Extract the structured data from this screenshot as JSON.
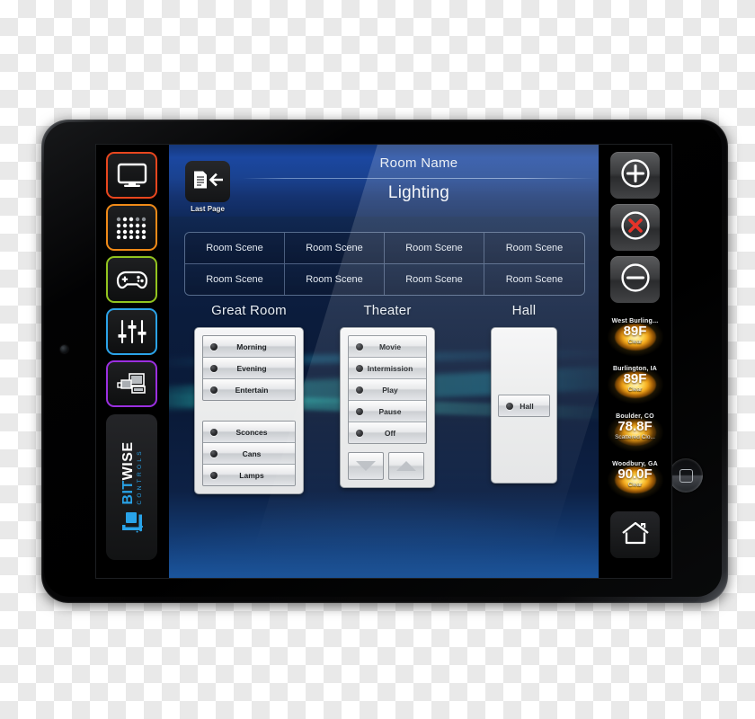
{
  "device": {
    "name": "tablet",
    "home_button": "home-hardware-button",
    "camera": "front-camera"
  },
  "header": {
    "last_page_label": "Last Page",
    "last_page_icon": "document-back-arrow-icon",
    "room_name": "Room Name",
    "page_title": "Lighting"
  },
  "scene_grid": {
    "cells": [
      "Room Scene",
      "Room Scene",
      "Room Scene",
      "Room Scene",
      "Room Scene",
      "Room Scene",
      "Room Scene",
      "Room Scene"
    ]
  },
  "zones": [
    {
      "title": "Great Room",
      "groups": [
        {
          "buttons": [
            "Morning",
            "Evening",
            "Entertain"
          ]
        },
        {
          "buttons": [
            "Sconces",
            "Cans",
            "Lamps"
          ]
        }
      ],
      "has_updown": false
    },
    {
      "title": "Theater",
      "groups": [
        {
          "buttons": [
            "Movie",
            "Intermission",
            "Play",
            "Pause",
            "Off"
          ]
        }
      ],
      "has_updown": true,
      "updown": {
        "down_icon": "triangle-down-icon",
        "up_icon": "triangle-up-icon"
      }
    },
    {
      "title": "Hall",
      "groups": [
        {
          "buttons": [
            "Hall"
          ]
        }
      ],
      "has_updown": false
    }
  ],
  "sidebar": {
    "items": [
      {
        "name": "display",
        "icon": "monitor-icon",
        "color": "#e8461e"
      },
      {
        "name": "keypad",
        "icon": "dot-matrix-keypad-icon",
        "color": "#f08a18"
      },
      {
        "name": "games",
        "icon": "game-controller-icon",
        "color": "#92c41f"
      },
      {
        "name": "audio",
        "icon": "sliders-icon",
        "color": "#2ba3e8"
      },
      {
        "name": "theater",
        "icon": "projector-screen-icon",
        "color": "#9b2fe0"
      }
    ],
    "logo": {
      "line1_a": "BIT",
      "line1_b": "WISE",
      "line2": "CONTROLS",
      "color": "#29a3e8"
    }
  },
  "right_rail": {
    "buttons": [
      {
        "name": "add",
        "icon": "plus-circle-icon",
        "color": "#ffffff"
      },
      {
        "name": "close",
        "icon": "x-circle-icon",
        "color": "#e63329"
      },
      {
        "name": "remove",
        "icon": "minus-circle-icon",
        "color": "#ffffff"
      }
    ],
    "home": {
      "name": "home",
      "icon": "home-icon"
    }
  },
  "weather": [
    {
      "city": "West Burling...",
      "temp": "89F",
      "condition": "Clear",
      "icon": "sun-icon"
    },
    {
      "city": "Burlington, IA",
      "temp": "89F",
      "condition": "Clear",
      "icon": "sun-icon"
    },
    {
      "city": "Boulder, CO",
      "temp": "78.8F",
      "condition": "Scattered Clo...",
      "icon": "sun-icon"
    },
    {
      "city": "Woodbury, GA",
      "temp": "90.0F",
      "condition": "Clear",
      "icon": "sun-icon"
    }
  ]
}
